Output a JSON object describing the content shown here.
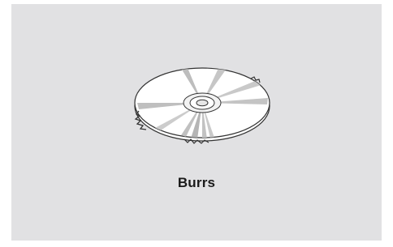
{
  "illustration": {
    "icon": "compact-disc-with-burrs",
    "caption": "Burrs"
  },
  "colors": {
    "background": "#e1e1e3",
    "disc_fill": "#ffffff",
    "stroke": "#333333",
    "reflection": "#b8b8b8"
  }
}
